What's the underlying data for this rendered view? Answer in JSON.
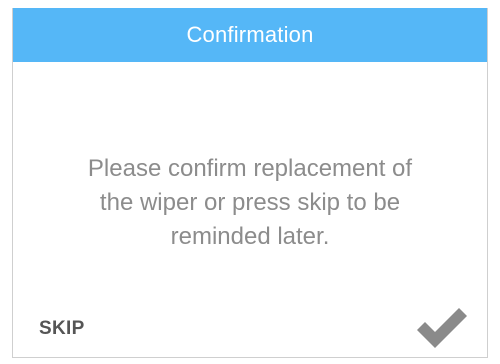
{
  "dialog": {
    "title": "Confirmation",
    "message_lines": [
      "Please confirm replacement of",
      "the wiper or press skip to be",
      "reminded later."
    ],
    "skip_label": "SKIP",
    "confirm_icon": "checkmark-icon"
  },
  "colors": {
    "header_bg": "#55b7f7",
    "title_text": "#ffffff",
    "message_text": "#8c8c8c",
    "skip_text": "#555555",
    "checkmark": "#8a8a8a"
  }
}
